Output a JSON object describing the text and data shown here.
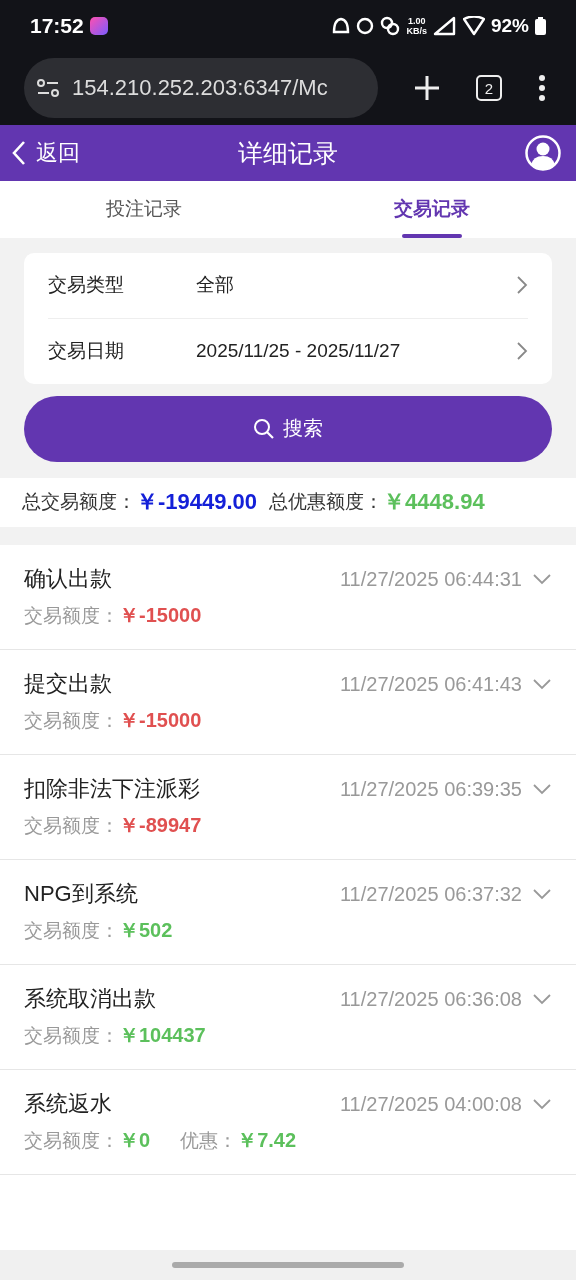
{
  "status_bar": {
    "time": "17:52",
    "speed_value": "1.00",
    "speed_unit": "KB/s",
    "battery": "92%"
  },
  "browser": {
    "url": "154.210.252.203:6347/Mc",
    "tab_count": "2"
  },
  "header": {
    "back": "返回",
    "title": "详细记录"
  },
  "tabs": [
    {
      "label": "投注记录",
      "selected": false
    },
    {
      "label": "交易记录",
      "selected": true
    }
  ],
  "filters": [
    {
      "label": "交易类型",
      "value": "全部"
    },
    {
      "label": "交易日期",
      "value": "2025/11/25 - 2025/11/27"
    }
  ],
  "search_button": "搜索",
  "totals": [
    {
      "label": "总交易额度：",
      "value": "￥-19449.00",
      "color": "#1420d8"
    },
    {
      "label": "总优惠额度：",
      "value": "￥4448.94",
      "color": "#5cc05c"
    }
  ],
  "records": [
    {
      "title": "确认出款",
      "time": "11/27/2025 06:44:31",
      "amounts": [
        {
          "label": "交易额度：",
          "value": "￥-15000",
          "color": "#e05050"
        }
      ]
    },
    {
      "title": "提交出款",
      "time": "11/27/2025 06:41:43",
      "amounts": [
        {
          "label": "交易额度：",
          "value": "￥-15000",
          "color": "#e05050"
        }
      ]
    },
    {
      "title": "扣除非法下注派彩",
      "time": "11/27/2025 06:39:35",
      "amounts": [
        {
          "label": "交易额度：",
          "value": "￥-89947",
          "color": "#e05050"
        }
      ]
    },
    {
      "title": "NPG到系统",
      "time": "11/27/2025 06:37:32",
      "amounts": [
        {
          "label": "交易额度：",
          "value": "￥502",
          "color": "#5cc05c"
        }
      ]
    },
    {
      "title": "系统取消出款",
      "time": "11/27/2025 06:36:08",
      "amounts": [
        {
          "label": "交易额度：",
          "value": "￥104437",
          "color": "#5cc05c"
        }
      ]
    },
    {
      "title": "系统返水",
      "time": "11/27/2025 04:00:08",
      "amounts": [
        {
          "label": "交易额度：",
          "value": "￥0",
          "color": "#5cc05c"
        },
        {
          "label": "优惠：",
          "value": "￥7.42",
          "color": "#5cc05c"
        }
      ]
    }
  ]
}
